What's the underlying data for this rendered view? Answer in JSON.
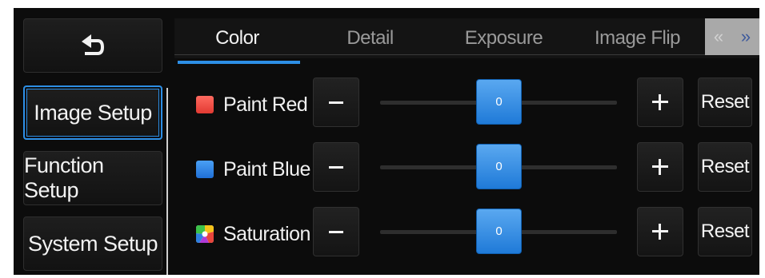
{
  "nav": {
    "back_icon": "back-arrow-icon",
    "items": [
      {
        "label": "Image Setup",
        "active": true
      },
      {
        "label": "Function Setup",
        "active": false
      },
      {
        "label": "System Setup",
        "active": false
      }
    ]
  },
  "tabs": [
    {
      "label": "Color",
      "active": true
    },
    {
      "label": "Detail",
      "active": false
    },
    {
      "label": "Exposure",
      "active": false
    },
    {
      "label": "Image Flip",
      "active": false
    }
  ],
  "pager": {
    "prev": "«",
    "next": "»"
  },
  "rows": [
    {
      "label": "Paint Red",
      "icon": "red-square-icon",
      "color": "#e8453c",
      "value": "0",
      "level": 0.5,
      "reset": "Reset"
    },
    {
      "label": "Paint Blue",
      "icon": "blue-square-icon",
      "color": "#2d7fe0",
      "value": "0",
      "level": 0.5,
      "reset": "Reset"
    },
    {
      "label": "Saturation",
      "icon": "color-wheel-icon",
      "color": "multicolor",
      "value": "0",
      "level": 0.5,
      "reset": "Reset"
    }
  ],
  "colors": {
    "accent": "#2d8fe6",
    "background": "#0c0c0c"
  }
}
